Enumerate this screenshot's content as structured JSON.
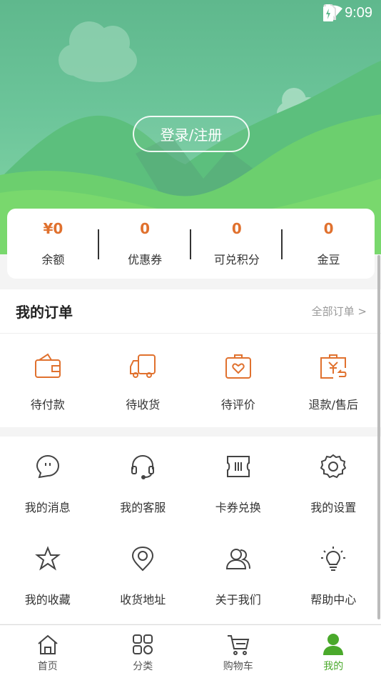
{
  "status": {
    "time": "9:09"
  },
  "header": {
    "login_label": "登录/注册"
  },
  "wallet": [
    {
      "value": "¥0",
      "label": "余额"
    },
    {
      "value": "0",
      "label": "优惠券"
    },
    {
      "value": "0",
      "label": "可兑积分"
    },
    {
      "value": "0",
      "label": "金豆"
    }
  ],
  "orders": {
    "title": "我的订单",
    "all_label": "全部订单 >",
    "items": [
      {
        "label": "待付款",
        "icon": "wallet-icon"
      },
      {
        "label": "待收货",
        "icon": "truck-icon"
      },
      {
        "label": "待评价",
        "icon": "review-icon"
      },
      {
        "label": "退款/售后",
        "icon": "refund-icon"
      }
    ]
  },
  "services": [
    {
      "label": "我的消息",
      "icon": "message-icon"
    },
    {
      "label": "我的客服",
      "icon": "headset-icon"
    },
    {
      "label": "卡券兑换",
      "icon": "coupon-icon"
    },
    {
      "label": "我的设置",
      "icon": "gear-icon"
    },
    {
      "label": "我的收藏",
      "icon": "star-icon"
    },
    {
      "label": "收货地址",
      "icon": "location-icon"
    },
    {
      "label": "关于我们",
      "icon": "users-icon"
    },
    {
      "label": "帮助中心",
      "icon": "bulb-icon"
    }
  ],
  "tabs": [
    {
      "label": "首页",
      "icon": "home-icon"
    },
    {
      "label": "分类",
      "icon": "grid-icon"
    },
    {
      "label": "购物车",
      "icon": "cart-icon"
    },
    {
      "label": "我的",
      "icon": "user-icon",
      "active": true
    }
  ],
  "colors": {
    "accent_orange": "#e0712e",
    "active_green": "#4aa92b",
    "header_green": "#6cc59a"
  }
}
